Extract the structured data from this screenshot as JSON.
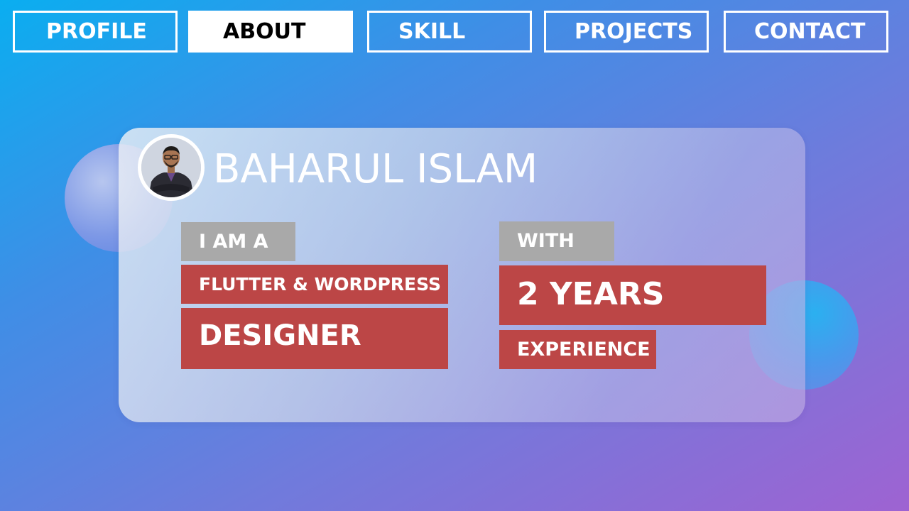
{
  "nav": {
    "tabs": [
      {
        "label": "PROFILE",
        "active": false
      },
      {
        "label": "ABOUT",
        "active": true
      },
      {
        "label": "SKILL",
        "active": false
      },
      {
        "label": "PROJECTS",
        "active": false
      },
      {
        "label": "CONTACT",
        "active": false
      }
    ]
  },
  "profile": {
    "name": "BAHARUL ISLAM",
    "avatar_icon": "person-photo-icon"
  },
  "about": {
    "intro_label": "I AM A",
    "role_line1": "FLUTTER & WORDPRESS",
    "role_line2": "DESIGNER",
    "with_label": "WITH",
    "years": "2 YEARS",
    "experience_label": "EXPERIENCE"
  },
  "colors": {
    "gradient_start": "#0aaef0",
    "gradient_end": "#9e63d2",
    "accent_red": "#bc4646",
    "label_gray": "#a9a9a9",
    "nav_active_bg": "#ffffff"
  }
}
